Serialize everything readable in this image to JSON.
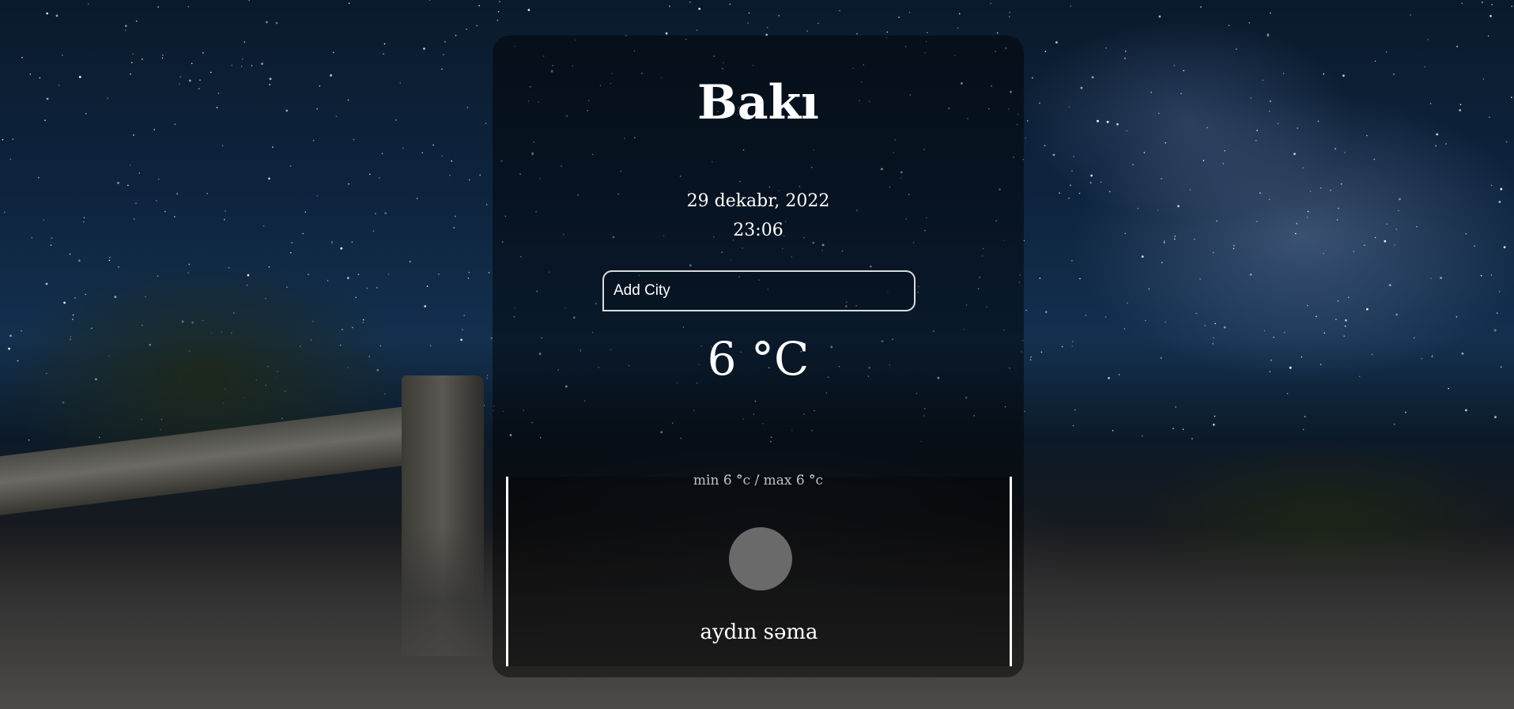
{
  "weather": {
    "city": "Bakı",
    "date": "29 dekabr, 2022",
    "time": "23:06",
    "search_placeholder": "Add City",
    "temperature": "6 °C",
    "min_max": "min 6 °c / max 6 °c",
    "description": "aydın səma",
    "icon": "clear-sky-moon-icon",
    "icon_color": "#6a6a6a"
  }
}
